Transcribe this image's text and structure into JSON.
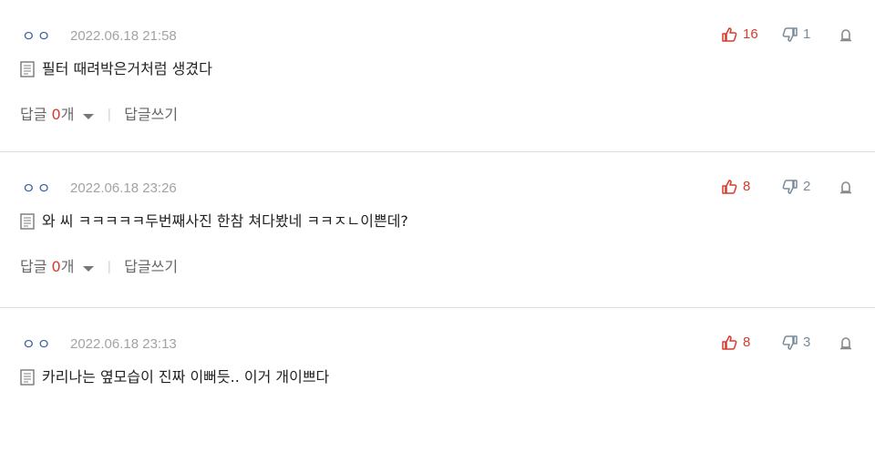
{
  "comments": [
    {
      "author": "ㅇㅇ",
      "date": "2022.06.18 21:58",
      "upvotes": "16",
      "downvotes": "1",
      "text": "필터 때려박은거처럼 생겼다",
      "reply_label": "답글",
      "reply_count": "0",
      "reply_unit": "개",
      "write_reply": "답글쓰기"
    },
    {
      "author": "ㅇㅇ",
      "date": "2022.06.18 23:26",
      "upvotes": "8",
      "downvotes": "2",
      "text": "와 씨 ㅋㅋㅋㅋㅋ두번째사진 한참 쳐다봤네 ㅋㅋㅈㄴ이쁜데?",
      "reply_label": "답글",
      "reply_count": "0",
      "reply_unit": "개",
      "write_reply": "답글쓰기"
    },
    {
      "author": "ㅇㅇ",
      "date": "2022.06.18 23:13",
      "upvotes": "8",
      "downvotes": "3",
      "text": "카리나는 옆모습이 진짜 이뻐듯.. 이거 개이쁘다"
    }
  ],
  "colors": {
    "accent_red": "#d63b2f",
    "author_blue": "#3a5fa0",
    "muted": "#a3a3a3"
  }
}
